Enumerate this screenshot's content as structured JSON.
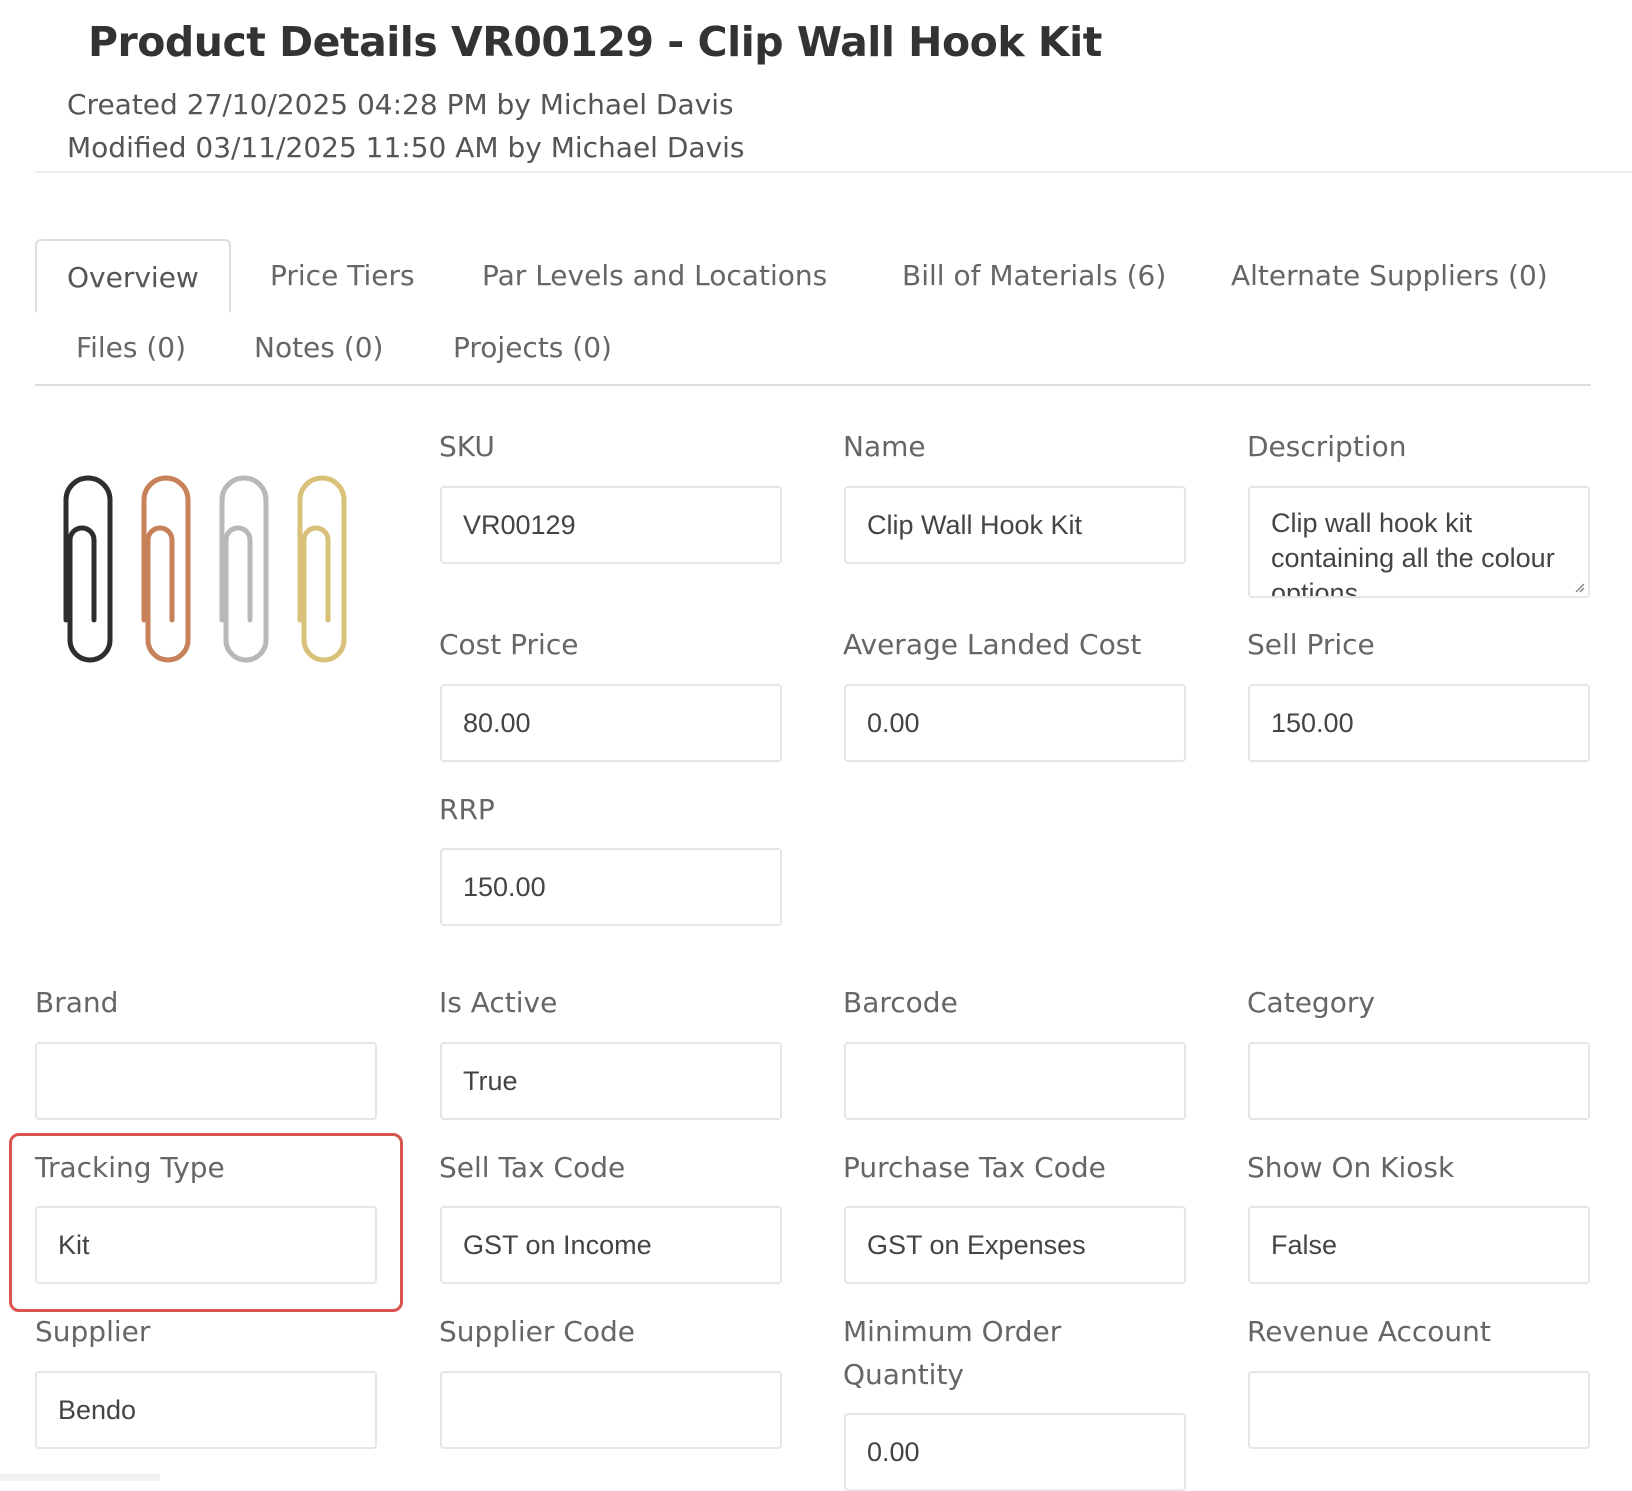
{
  "header": {
    "title": "Product Details VR00129 - Clip Wall Hook Kit",
    "created": "Created 27/10/2025 04:28 PM by Michael Davis",
    "modified": "Modified 03/11/2025 11:50 AM by Michael Davis"
  },
  "tabs": [
    {
      "label": "Overview",
      "active": true
    },
    {
      "label": "Price Tiers"
    },
    {
      "label": "Par Levels and Locations"
    },
    {
      "label": "Bill of Materials (6)"
    },
    {
      "label": "Alternate Suppliers (0)"
    },
    {
      "label": "Files (0)"
    },
    {
      "label": "Notes (0)"
    },
    {
      "label": "Projects (0)"
    }
  ],
  "product_image": {
    "icon": "paperclips-image",
    "colors": [
      "#2e2e2e",
      "#c8825a",
      "#b8b8b8",
      "#d8c27a"
    ]
  },
  "fields": {
    "sku": {
      "label": "SKU",
      "value": "VR00129"
    },
    "name": {
      "label": "Name",
      "value": "Clip Wall Hook Kit"
    },
    "description": {
      "label": "Description",
      "value": "Clip wall hook kit containing all the colour options."
    },
    "cost_price": {
      "label": "Cost Price",
      "value": "80.00"
    },
    "average_landed_cost": {
      "label": "Average Landed Cost",
      "value": "0.00"
    },
    "sell_price": {
      "label": "Sell Price",
      "value": "150.00"
    },
    "rrp": {
      "label": "RRP",
      "value": "150.00"
    },
    "brand": {
      "label": "Brand",
      "value": ""
    },
    "is_active": {
      "label": "Is Active",
      "value": "True"
    },
    "barcode": {
      "label": "Barcode",
      "value": ""
    },
    "category": {
      "label": "Category",
      "value": ""
    },
    "tracking_type": {
      "label": "Tracking Type",
      "value": "Kit"
    },
    "sell_tax_code": {
      "label": "Sell Tax Code",
      "value": "GST on Income"
    },
    "purchase_tax_code": {
      "label": "Purchase Tax Code",
      "value": "GST on Expenses"
    },
    "show_on_kiosk": {
      "label": "Show On Kiosk",
      "value": "False"
    },
    "supplier": {
      "label": "Supplier",
      "value": "Bendo"
    },
    "supplier_code": {
      "label": "Supplier Code",
      "value": ""
    },
    "minimum_order_quantity": {
      "label": "Minimum Order Quantity",
      "value": "0.00"
    },
    "revenue_account": {
      "label": "Revenue Account",
      "value": ""
    }
  },
  "colors": {
    "highlight": "#d9534f",
    "border": "#e6e6e6"
  }
}
